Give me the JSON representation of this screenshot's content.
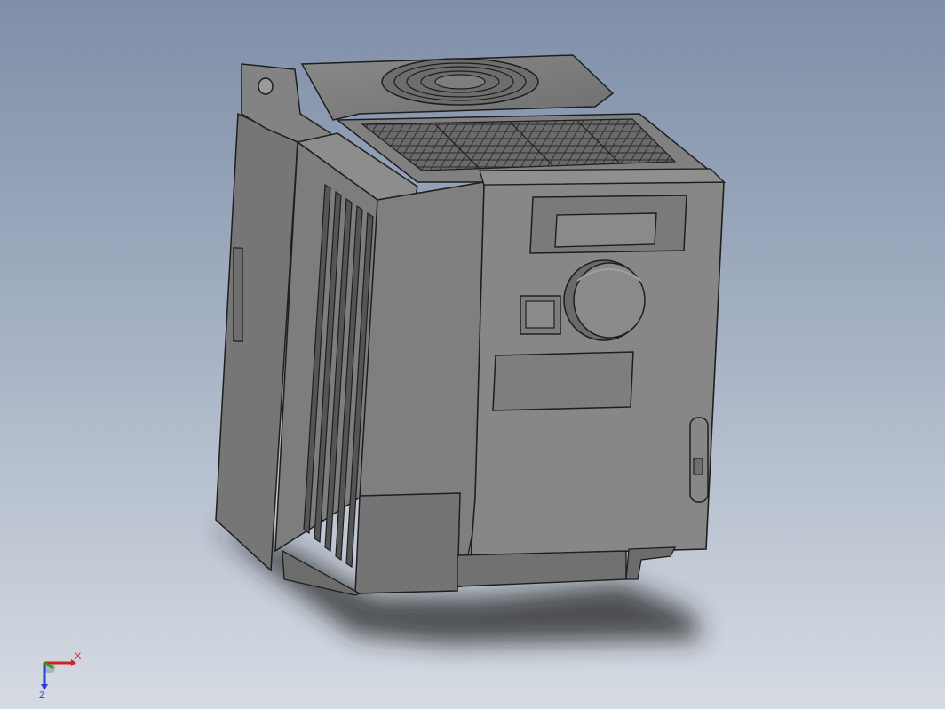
{
  "viewport": {
    "background_top": "#7f8fa8",
    "background_bottom": "#d6dbe3"
  },
  "model": {
    "body_color": "#7b7b7b",
    "face_color": "#858585",
    "dark_color": "#5e5e5e",
    "edge_color": "#1e1e1e",
    "shadow_color": "#2a2a33"
  },
  "triad": {
    "x_label": "X",
    "z_label": "Z",
    "x_color": "#d42020",
    "y_color": "#1fa31f",
    "z_color": "#2a3fd0"
  }
}
